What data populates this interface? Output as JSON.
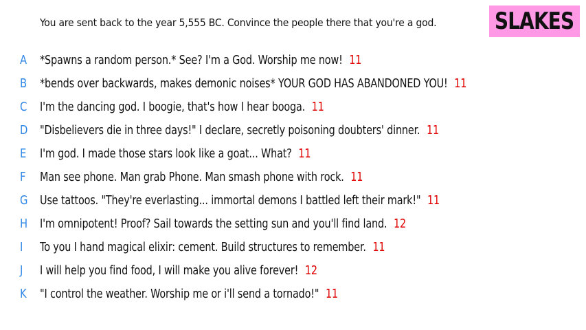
{
  "prompt": "You are sent back to the year 5,555 BC. Convince the people there that you're a god.",
  "logo": {
    "text": "SLAKES",
    "bg_color": "#ff99e6"
  },
  "colors": {
    "letter": "#2e86e6",
    "score": "#e00000",
    "text": "#111111"
  },
  "answers": [
    {
      "letter": "A",
      "text": "*Spawns a random person.* See? I'm a God. Worship me now!",
      "score": "11"
    },
    {
      "letter": "B",
      "text": "*bends over backwards, makes demonic noises* YOUR GOD HAS ABANDONED YOU!",
      "score": "11"
    },
    {
      "letter": "C",
      "text": "I'm the dancing god. I boogie, that's how I hear booga.",
      "score": "11"
    },
    {
      "letter": "D",
      "text": "\"Disbelievers die in three days!\" I declare, secretly poisoning doubters' dinner.",
      "score": "11"
    },
    {
      "letter": "E",
      "text": "I'm god. I made those stars look like a goat... What?",
      "score": "11"
    },
    {
      "letter": "F",
      "text": "Man see phone. Man grab Phone. Man smash phone with rock.",
      "score": "11"
    },
    {
      "letter": "G",
      "text": "Use tattoos. \"They're everlasting... immortal demons I battled left their mark!\"",
      "score": "11"
    },
    {
      "letter": "H",
      "text": "I'm omnipotent! Proof? Sail towards the setting sun and you'll find land.",
      "score": "12"
    },
    {
      "letter": "I",
      "text": "To you I hand magical elixir: cement. Build structures to remember.",
      "score": "11"
    },
    {
      "letter": "J",
      "text": "I will help you find food, I will make you alive forever!",
      "score": "12"
    },
    {
      "letter": "K",
      "text": "\"I control the weather. Worship me or i'll send a tornado!\"",
      "score": "11"
    }
  ]
}
